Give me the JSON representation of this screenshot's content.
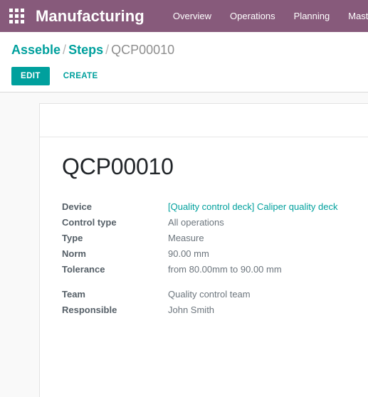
{
  "navbar": {
    "apps_icon": "apps-grid-icon",
    "brand": "Manufacturing",
    "menu_items": [
      {
        "label": "Overview"
      },
      {
        "label": "Operations"
      },
      {
        "label": "Planning"
      },
      {
        "label": "Master"
      }
    ],
    "background_color": "#875A7B"
  },
  "control_panel": {
    "breadcrumb": {
      "root": "Asseble",
      "separator": "/",
      "parent": "Steps",
      "current": "QCP00010"
    },
    "buttons": {
      "edit_label": "EDIT",
      "create_label": "CREATE"
    },
    "accent_color": "#00A09D"
  },
  "record": {
    "title": "QCP00010",
    "groups": [
      {
        "fields": [
          {
            "label": "Device",
            "value": "[Quality control deck] Caliper quality deck",
            "is_link": true
          },
          {
            "label": "Control type",
            "value": "All operations",
            "is_link": false
          },
          {
            "label": "Type",
            "value": "Measure",
            "is_link": false
          },
          {
            "label": "Norm",
            "value": "90.00 mm",
            "is_link": false
          },
          {
            "label": "Tolerance",
            "value": "from 80.00mm to 90.00 mm",
            "is_link": false
          }
        ]
      },
      {
        "fields": [
          {
            "label": "Team",
            "value": "Quality control team",
            "is_link": false
          },
          {
            "label": "Responsible",
            "value": "John Smith",
            "is_link": false
          }
        ]
      }
    ]
  }
}
